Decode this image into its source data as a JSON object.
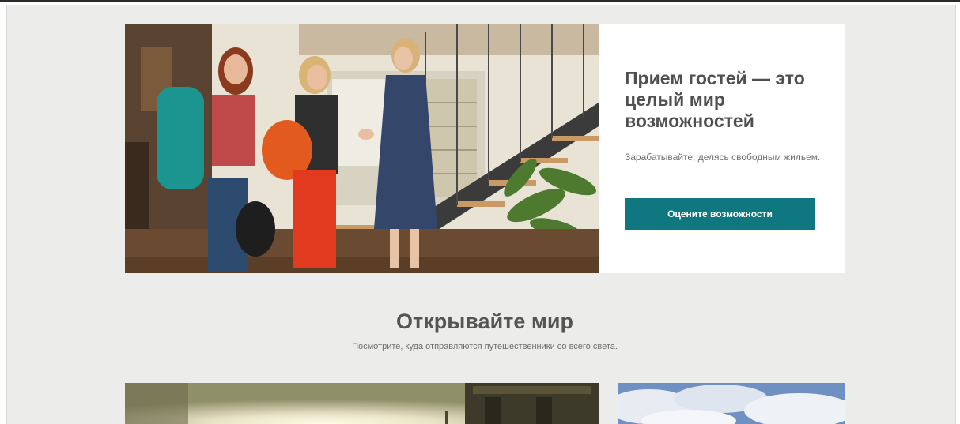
{
  "hero": {
    "title": "Прием гостей — это целый мир возможностей",
    "subtitle": "Зарабатывайте, делясь свободным жильем.",
    "cta_label": "Оцените возможности",
    "accent_color": "#0e7780"
  },
  "discover": {
    "title": "Открывайте мир",
    "subtitle": "Посмотрите, куда отправляются путешественники со всего света."
  }
}
